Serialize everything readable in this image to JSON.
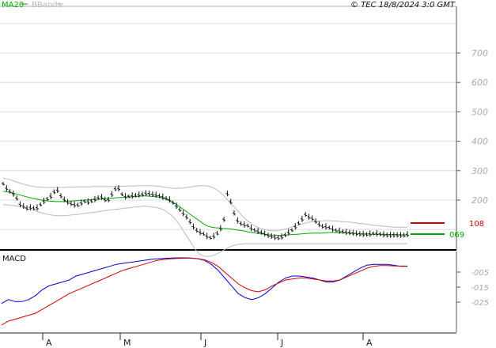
{
  "header": {
    "legend_ma": "MA20",
    "legend_bbands": "BBands",
    "copyright": "© TEC 18/8/2024 3:0 GMT"
  },
  "colors": {
    "ma": "#00aa00",
    "bbands": "#bbbbbb",
    "price": "#111111",
    "macd": "#0000cc",
    "signal": "#cc0000",
    "marker_red": "#cc0000",
    "marker_green": "#00aa00"
  },
  "chart_data": [
    {
      "type": "line",
      "name": "price-panel",
      "yticks": [
        "700",
        "600",
        "500",
        "400",
        "300",
        "200"
      ],
      "ylim": [
        60,
        800
      ],
      "xticks": [
        "A",
        "M",
        "J",
        "J",
        "A"
      ],
      "n_points": 120,
      "series": [
        {
          "name": "MA20",
          "values": [
            230,
            228,
            225,
            222,
            218,
            214,
            210,
            207,
            204,
            201,
            199,
            197,
            196,
            195,
            195,
            195,
            196,
            197,
            198,
            199,
            200,
            201,
            202,
            203,
            204,
            205,
            206,
            207,
            208,
            209,
            210,
            211,
            212,
            213,
            214,
            214,
            213,
            212,
            210,
            207,
            202,
            196,
            189,
            180,
            170,
            160,
            150,
            140,
            130,
            120,
            112,
            108,
            106,
            105,
            104,
            103,
            101,
            99,
            97,
            95,
            92,
            90,
            88,
            86,
            84,
            82,
            81,
            80,
            80,
            81,
            82,
            83,
            84,
            85,
            86,
            87,
            88,
            88,
            88,
            89,
            90,
            90,
            89,
            89,
            88,
            88,
            87,
            86,
            85,
            85,
            84,
            84,
            84,
            84,
            83,
            83,
            83,
            82,
            82,
            82
          ]
        },
        {
          "name": "BBands-upper",
          "values": [
            275,
            272,
            268,
            263,
            258,
            254,
            250,
            247,
            245,
            244,
            243,
            243,
            243,
            243,
            243,
            243,
            244,
            244,
            245,
            245,
            245,
            245,
            246,
            246,
            246,
            246,
            246,
            246,
            247,
            247,
            247,
            248,
            248,
            249,
            249,
            249,
            249,
            248,
            247,
            245,
            243,
            241,
            240,
            240,
            241,
            243,
            245,
            247,
            249,
            249,
            248,
            245,
            238,
            228,
            215,
            200,
            185,
            170,
            155,
            140,
            128,
            118,
            110,
            104,
            100,
            97,
            96,
            96,
            98,
            101,
            105,
            110,
            114,
            118,
            122,
            125,
            127,
            128,
            129,
            130,
            130,
            129,
            128,
            127,
            126,
            125,
            123,
            121,
            120,
            118,
            116,
            114,
            113,
            112,
            110,
            109,
            108,
            108,
            108,
            108
          ]
        },
        {
          "name": "BBands-lower",
          "values": [
            185,
            184,
            182,
            181,
            178,
            174,
            170,
            167,
            163,
            158,
            155,
            151,
            149,
            147,
            147,
            147,
            148,
            150,
            151,
            153,
            155,
            157,
            158,
            160,
            162,
            164,
            166,
            168,
            169,
            171,
            173,
            174,
            176,
            177,
            179,
            179,
            177,
            176,
            173,
            169,
            161,
            151,
            138,
            120,
            99,
            77,
            55,
            33,
            18,
            10,
            8,
            10,
            15,
            22,
            30,
            38,
            44,
            48,
            50,
            52,
            52,
            52,
            52,
            52,
            52,
            52,
            52,
            52,
            52,
            52,
            52,
            52,
            52,
            52,
            52,
            52,
            52,
            52,
            52,
            52,
            52,
            52,
            52,
            52,
            52,
            52,
            52,
            52,
            52,
            52,
            52,
            52,
            52,
            52,
            52,
            52,
            52,
            52,
            52,
            52
          ]
        },
        {
          "name": "Price",
          "values": [
            255,
            235,
            225,
            215,
            185,
            178,
            170,
            175,
            168,
            182,
            195,
            205,
            215,
            240,
            215,
            200,
            190,
            185,
            180,
            188,
            195,
            192,
            198,
            205,
            210,
            200,
            200,
            230,
            245,
            220,
            210,
            212,
            214,
            216,
            218,
            222,
            220,
            218,
            214,
            210,
            205,
            198,
            185,
            170,
            155,
            140,
            120,
            100,
            90,
            85,
            75,
            70,
            80,
            95,
            125,
            230,
            180,
            135,
            120,
            115,
            112,
            100,
            95,
            90,
            85,
            78,
            75,
            70,
            72,
            80,
            90,
            100,
            115,
            130,
            150,
            140,
            135,
            120,
            110,
            108,
            105,
            98,
            95,
            92,
            90,
            88,
            86,
            84,
            83,
            82,
            84,
            86,
            84,
            82,
            80,
            80,
            80,
            80,
            79,
            82
          ]
        }
      ],
      "markers": [
        {
          "label": "108",
          "color": "#cc0000"
        },
        {
          "label": "069",
          "color": "#00aa00"
        }
      ]
    },
    {
      "type": "line",
      "name": "macd-panel",
      "title": "MACD",
      "yticks": [
        "-005",
        "-015",
        "-025"
      ],
      "ylim": [
        -35,
        5
      ],
      "series": [
        {
          "name": "MACD",
          "values": [
            -22,
            -20,
            -21,
            -21,
            -20,
            -18,
            -15,
            -13,
            -12,
            -11,
            -10,
            -8,
            -7,
            -6,
            -5,
            -4,
            -3,
            -2,
            -1.5,
            -1,
            -0.5,
            0,
            0.5,
            0.8,
            1,
            1.2,
            1.3,
            1.3,
            1.2,
            0.8,
            0,
            -2,
            -5,
            -9,
            -13,
            -17,
            -19,
            -20,
            -19,
            -17,
            -14,
            -11,
            -9,
            -8,
            -8,
            -8.5,
            -9,
            -10,
            -11,
            -11,
            -10,
            -8,
            -6,
            -4,
            -2.5,
            -2,
            -2,
            -2,
            -2.5,
            -3,
            -3
          ]
        },
        {
          "name": "Signal",
          "values": [
            -33,
            -31,
            -30,
            -29,
            -28,
            -27,
            -25,
            -23,
            -21,
            -19,
            -17,
            -15.5,
            -14,
            -12.5,
            -11,
            -9.5,
            -8,
            -6.5,
            -5,
            -4,
            -3,
            -2,
            -1,
            0,
            0.5,
            0.8,
            1,
            1.1,
            1.1,
            0.9,
            0.3,
            -1,
            -3,
            -6,
            -9,
            -12,
            -14,
            -15.5,
            -16,
            -15,
            -13,
            -11.5,
            -10,
            -9.5,
            -9,
            -9,
            -9.5,
            -10,
            -10.5,
            -10.5,
            -10,
            -8.5,
            -7,
            -5.5,
            -4,
            -3,
            -2.6,
            -2.6,
            -2.8,
            -2.9,
            -2.9
          ]
        }
      ]
    }
  ]
}
